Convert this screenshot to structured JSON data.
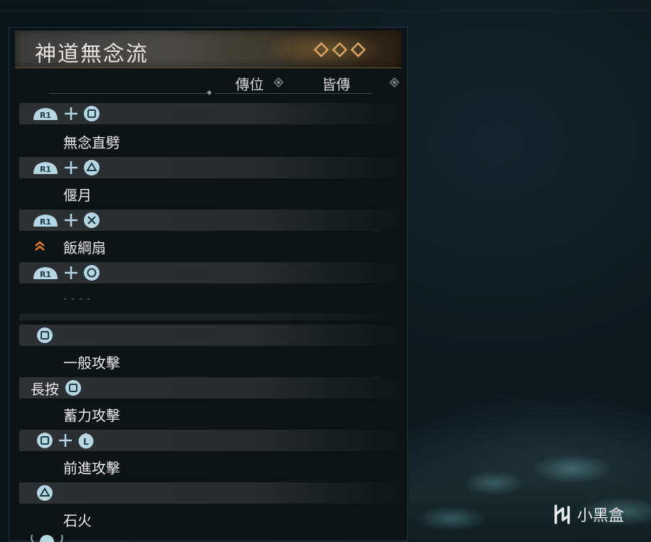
{
  "panel": {
    "title": "神道無念流",
    "rank_label_1": "傳位",
    "rank_label_2": "皆傳"
  },
  "moves": [
    {
      "input": [
        "R1",
        "+",
        "square"
      ],
      "name": "無念直劈"
    },
    {
      "input": [
        "R1",
        "+",
        "triangle"
      ],
      "name": "偃月"
    },
    {
      "input": [
        "R1",
        "+",
        "cross"
      ],
      "name": "飯綱扇",
      "upgrade": true
    },
    {
      "input": [
        "R1",
        "+",
        "circle"
      ],
      "name": "----"
    },
    {
      "input": [
        "square"
      ],
      "name": "一般攻擊"
    },
    {
      "prefix": "長按",
      "input": [
        "square"
      ],
      "name": "蓄力攻擊"
    },
    {
      "input": [
        "square",
        "+",
        "L-stick-up"
      ],
      "name": "前進攻擊"
    },
    {
      "input": [
        "triangle"
      ],
      "name": "石火"
    }
  ],
  "button_labels": {
    "r1": "R1",
    "l_stick": "L"
  },
  "colors": {
    "accent_gold": "#c8884a",
    "upgrade_orange": "#e07a2a",
    "button_blue": "#b6d6e2"
  },
  "watermark": {
    "text": "小黑盒"
  }
}
